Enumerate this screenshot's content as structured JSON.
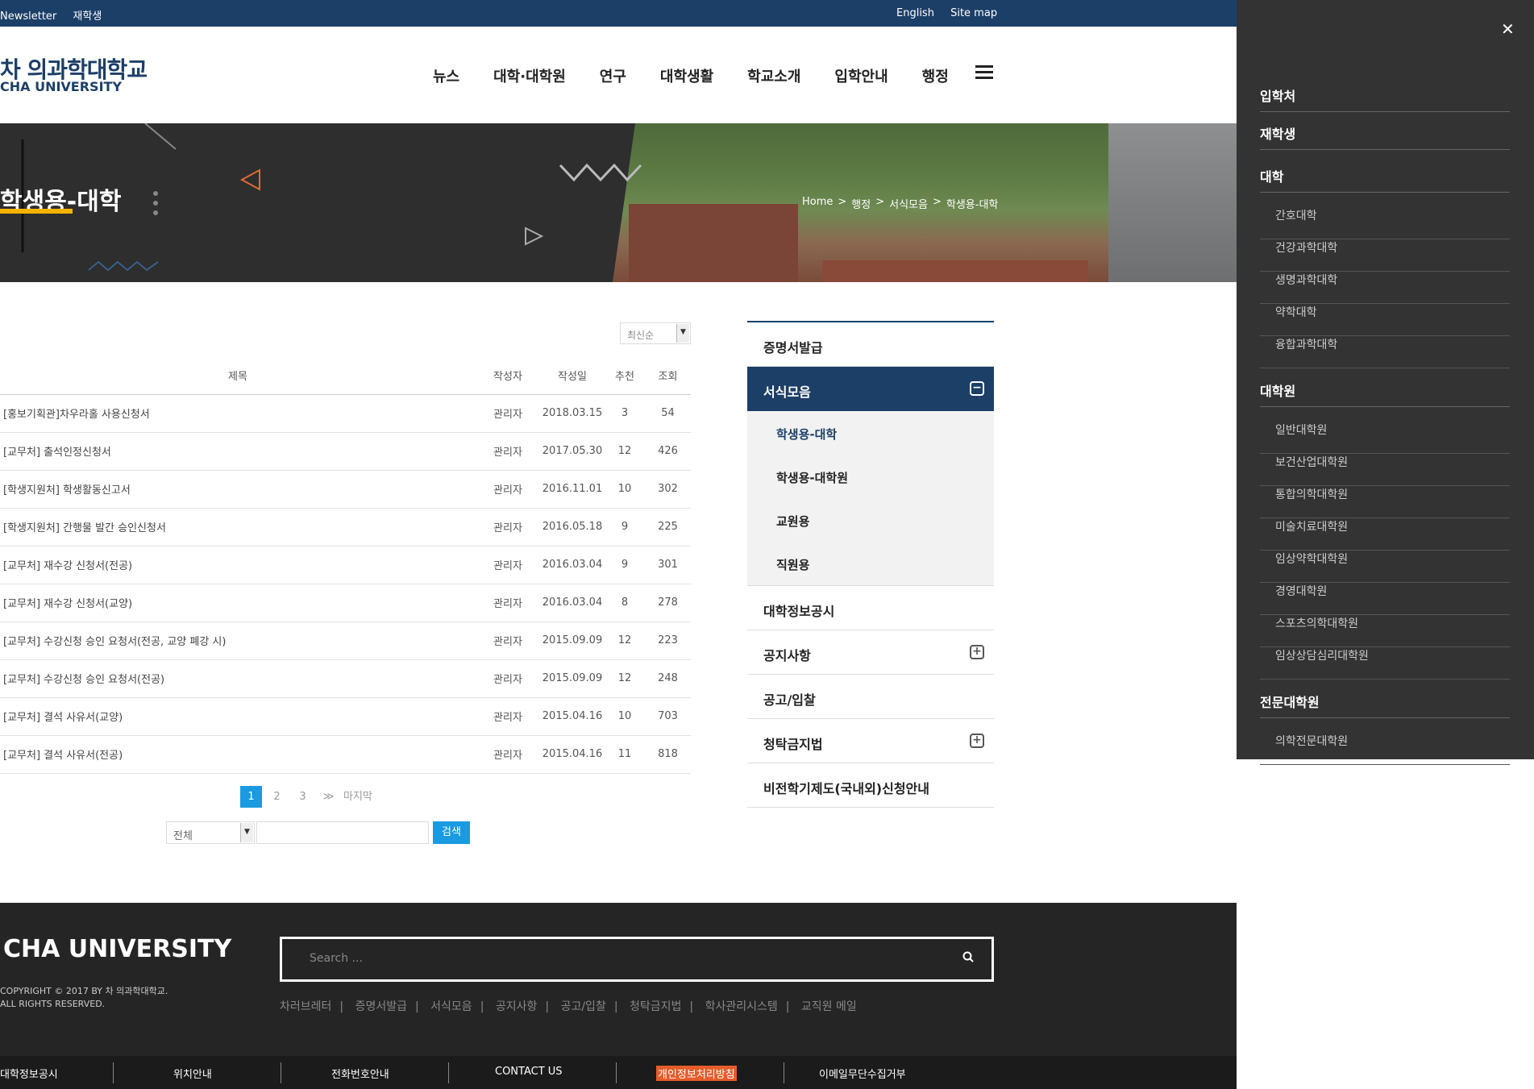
{
  "topbar": {
    "left_items": [
      "Newsletter",
      "재학생"
    ],
    "right_items": [
      "English",
      "Site map"
    ]
  },
  "header": {
    "logo_kr": "차 의과학대학교",
    "logo_en": "CHA UNIVERSITY",
    "nav": [
      "뉴스",
      "대학·대학원",
      "연구",
      "대학생활",
      "학교소개",
      "입학안내",
      "행정"
    ]
  },
  "banner": {
    "title": "학생용-대학",
    "breadcrumb": [
      "Home",
      ">",
      "행정",
      ">",
      "서식모음",
      ">",
      "학생용-대학"
    ]
  },
  "board": {
    "sort_value": "최신순",
    "columns": [
      "제목",
      "작성자",
      "작성일",
      "추천",
      "조회"
    ],
    "rows": [
      {
        "title": "[홍보기획관]차우라홀 사용신청서",
        "author": "관리자",
        "date": "2018.03.15",
        "rec": "3",
        "views": "54"
      },
      {
        "title": "[교무처] 출석인정신청서",
        "author": "관리자",
        "date": "2017.05.30",
        "rec": "12",
        "views": "426"
      },
      {
        "title": "[학생지원처] 학생활동신고서",
        "author": "관리자",
        "date": "2016.11.01",
        "rec": "10",
        "views": "302"
      },
      {
        "title": "[학생지원처] 간행물 발간 승인신청서",
        "author": "관리자",
        "date": "2016.05.18",
        "rec": "9",
        "views": "225"
      },
      {
        "title": "[교무처] 재수강 신청서(전공)",
        "author": "관리자",
        "date": "2016.03.04",
        "rec": "9",
        "views": "301"
      },
      {
        "title": "[교무처] 재수강 신청서(교양)",
        "author": "관리자",
        "date": "2016.03.04",
        "rec": "8",
        "views": "278"
      },
      {
        "title": "[교무처] 수강신청 승인 요청서(전공, 교양 폐강 시)",
        "author": "관리자",
        "date": "2015.09.09",
        "rec": "12",
        "views": "223"
      },
      {
        "title": "[교무처] 수강신청 승인 요청서(전공)",
        "author": "관리자",
        "date": "2015.09.09",
        "rec": "12",
        "views": "248"
      },
      {
        "title": "[교무처] 결석 사유서(교양)",
        "author": "관리자",
        "date": "2015.04.16",
        "rec": "10",
        "views": "703"
      },
      {
        "title": "[교무처] 결석 사유서(전공)",
        "author": "관리자",
        "date": "2015.04.16",
        "rec": "11",
        "views": "818"
      }
    ],
    "pagination": [
      "1",
      "2",
      "3",
      "≫",
      "마지막"
    ],
    "search_select": "전체",
    "search_button": "검색"
  },
  "lnb": {
    "items": [
      "증명서발급",
      "서식모음",
      "대학정보공시",
      "공지사항",
      "공고/입찰",
      "청탁금지법",
      "비전학기제도(국내외)신청안내"
    ],
    "sub_items": [
      "학생용-대학",
      "학생용-대학원",
      "교원용",
      "직원용"
    ]
  },
  "footer": {
    "logo": "CHA UNIVERSITY",
    "copy_line1": "COPYRIGHT © 2017 BY 차 의과학대학교.",
    "copy_line2": "ALL RIGHTS RESERVED.",
    "search_placeholder": "Search ...",
    "links": [
      "차러브레터",
      "증명서발급",
      "서식모음",
      "공지사항",
      "공고/입찰",
      "청탁금지법",
      "학사관리시스템",
      "교직원 메일"
    ],
    "bottom": [
      "대학정보공시",
      "위치안내",
      "전화번호안내",
      "CONTACT US",
      "개인정보처리방침",
      "이메일무단수집거부"
    ]
  },
  "sitemap": {
    "top": [
      "입학처",
      "재학생"
    ],
    "college_head": "대학",
    "colleges": [
      "간호대학",
      "건강과학대학",
      "생명과학대학",
      "약학대학",
      "융합과학대학"
    ],
    "grad_head": "대학원",
    "grads": [
      "일반대학원",
      "보건산업대학원",
      "통합의학대학원",
      "미술치료대학원",
      "임상약학대학원",
      "경영대학원",
      "스포츠의학대학원",
      "임상상담심리대학원"
    ],
    "prof_head": "전문대학원",
    "profs": [
      "의학전문대학원"
    ]
  }
}
